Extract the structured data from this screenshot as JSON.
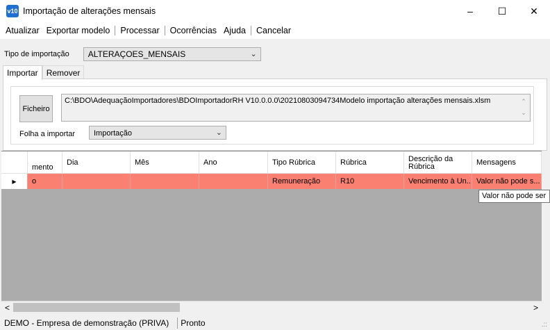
{
  "window": {
    "icon_text": "v10",
    "title": "Importação de alterações mensais",
    "minimize": "–",
    "maximize": "☐",
    "close": "✕"
  },
  "menu": [
    "Atualizar",
    "Exportar modelo",
    "Processar",
    "Ocorrências",
    "Ajuda",
    "Cancelar"
  ],
  "tipo_importacao": {
    "label": "Tipo de importação",
    "value": "ALTERAÇOES_MENSAIS"
  },
  "tabs": [
    "Importar",
    "Remover"
  ],
  "ficheiro": {
    "button": "Ficheiro",
    "path": "C:\\BDO\\AdequaçãoImportadores\\BDOImportadorRH V10.0.0.0\\20210803094734Modelo importação alterações mensais.xlsm"
  },
  "folha": {
    "label": "Folha a importar",
    "value": "Importação"
  },
  "grid": {
    "columns": [
      "mento",
      "Dia",
      "Mês",
      "Ano",
      "Tipo Rúbrica",
      "Rúbrica",
      "Descrição da Rúbrica",
      "Mensagens"
    ],
    "rows": [
      {
        "marker": "▶",
        "cells": [
          "o",
          "",
          "",
          "",
          "Remuneração",
          "R10",
          "Vencimento à Un...",
          "Valor não pode s..."
        ]
      }
    ]
  },
  "tooltip": "Valor não pode ser",
  "scroll": {
    "left": "<",
    "right": ">"
  },
  "status": {
    "company": "DEMO - Empresa de demonstração (PRIVA)",
    "state": "Pronto"
  },
  "colors": {
    "error_row": "#fa8072",
    "grid_empty": "#acacac"
  }
}
